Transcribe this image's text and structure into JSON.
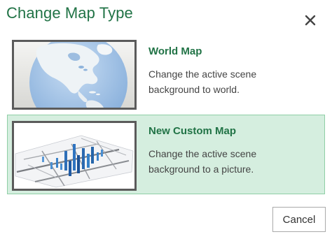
{
  "dialog": {
    "title": "Change Map Type",
    "close_icon": "close-icon"
  },
  "options": [
    {
      "name": "World Map",
      "description": "Change the active scene background to world.",
      "thumbnail": "globe-thumbnail",
      "selected": false
    },
    {
      "name": "New Custom Map",
      "description": "Change the active scene background to a picture.",
      "thumbnail": "custom-map-thumbnail",
      "selected": true
    }
  ],
  "buttons": {
    "cancel_label": "Cancel"
  },
  "colors": {
    "accent": "#217346",
    "selected_bg": "#d5eedf",
    "selected_border": "#8fcfa6",
    "thumb_border": "#5b5b5b"
  }
}
